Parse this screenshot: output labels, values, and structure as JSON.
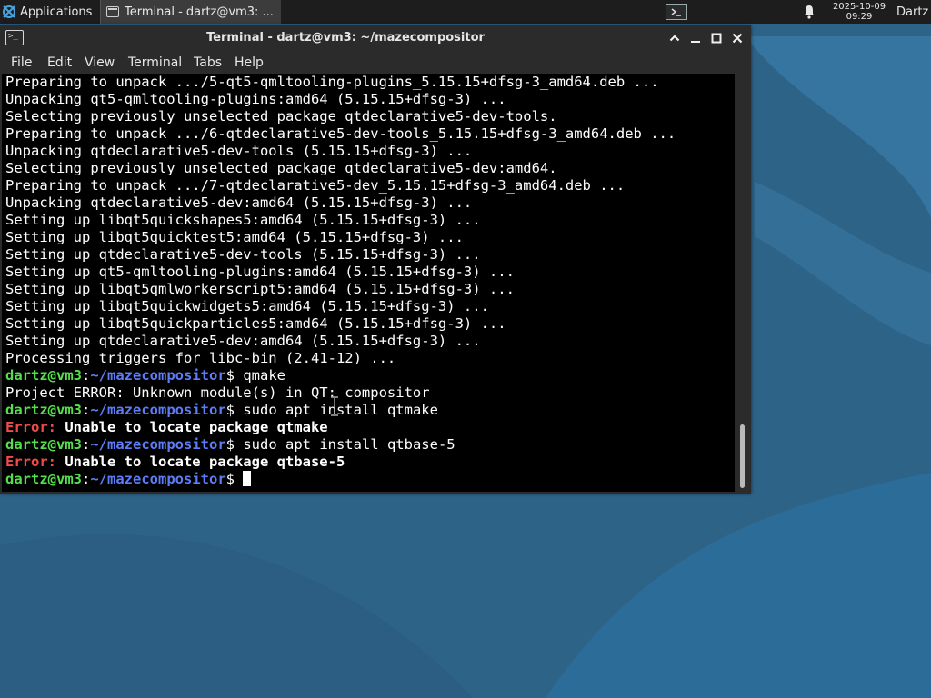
{
  "panel": {
    "applications_label": "Applications",
    "task_label": "Terminal - dartz@vm3: ...",
    "clock_date": "2025-10-09",
    "clock_time": "09:29",
    "user": "Dartz"
  },
  "window": {
    "title": "Terminal - dartz@vm3: ~/mazecompositor",
    "menu": [
      "File",
      "Edit",
      "View",
      "Terminal",
      "Tabs",
      "Help"
    ]
  },
  "terminal": {
    "lines": [
      {
        "type": "plain",
        "text": "Preparing to unpack .../5-qt5-qmltooling-plugins_5.15.15+dfsg-3_amd64.deb ..."
      },
      {
        "type": "plain",
        "text": "Unpacking qt5-qmltooling-plugins:amd64 (5.15.15+dfsg-3) ..."
      },
      {
        "type": "plain",
        "text": "Selecting previously unselected package qtdeclarative5-dev-tools."
      },
      {
        "type": "plain",
        "text": "Preparing to unpack .../6-qtdeclarative5-dev-tools_5.15.15+dfsg-3_amd64.deb ..."
      },
      {
        "type": "plain",
        "text": "Unpacking qtdeclarative5-dev-tools (5.15.15+dfsg-3) ..."
      },
      {
        "type": "plain",
        "text": "Selecting previously unselected package qtdeclarative5-dev:amd64."
      },
      {
        "type": "plain",
        "text": "Preparing to unpack .../7-qtdeclarative5-dev_5.15.15+dfsg-3_amd64.deb ..."
      },
      {
        "type": "plain",
        "text": "Unpacking qtdeclarative5-dev:amd64 (5.15.15+dfsg-3) ..."
      },
      {
        "type": "plain",
        "text": "Setting up libqt5quickshapes5:amd64 (5.15.15+dfsg-3) ..."
      },
      {
        "type": "plain",
        "text": "Setting up libqt5quicktest5:amd64 (5.15.15+dfsg-3) ..."
      },
      {
        "type": "plain",
        "text": "Setting up qtdeclarative5-dev-tools (5.15.15+dfsg-3) ..."
      },
      {
        "type": "plain",
        "text": "Setting up qt5-qmltooling-plugins:amd64 (5.15.15+dfsg-3) ..."
      },
      {
        "type": "plain",
        "text": "Setting up libqt5qmlworkerscript5:amd64 (5.15.15+dfsg-3) ..."
      },
      {
        "type": "plain",
        "text": "Setting up libqt5quickwidgets5:amd64 (5.15.15+dfsg-3) ..."
      },
      {
        "type": "plain",
        "text": "Setting up libqt5quickparticles5:amd64 (5.15.15+dfsg-3) ..."
      },
      {
        "type": "plain",
        "text": "Setting up qtdeclarative5-dev:amd64 (5.15.15+dfsg-3) ..."
      },
      {
        "type": "plain",
        "text": "Processing triggers for libc-bin (2.41-12) ..."
      },
      {
        "type": "prompt",
        "user": "dartz@vm3",
        "path": "~/mazecompositor",
        "cmd": "qmake"
      },
      {
        "type": "plain",
        "text": "Project ERROR: Unknown module(s) in QT: compositor"
      },
      {
        "type": "prompt",
        "user": "dartz@vm3",
        "path": "~/mazecompositor",
        "cmd": "sudo apt install qtmake"
      },
      {
        "type": "error",
        "label": "Error:",
        "text": " Unable to locate package qtmake"
      },
      {
        "type": "prompt",
        "user": "dartz@vm3",
        "path": "~/mazecompositor",
        "cmd": "sudo apt install qtbase-5"
      },
      {
        "type": "error",
        "label": "Error:",
        "text": " Unable to locate package qtbase-5"
      },
      {
        "type": "prompt",
        "user": "dartz@vm3",
        "path": "~/mazecompositor",
        "cmd": "",
        "cursor": true
      }
    ]
  },
  "colors": {
    "prompt_user": "#55e04b",
    "prompt_path": "#5c7cf8",
    "error": "#ef4b4b",
    "terminal_bg": "#000000",
    "chrome_bg": "#2b2b2b"
  }
}
